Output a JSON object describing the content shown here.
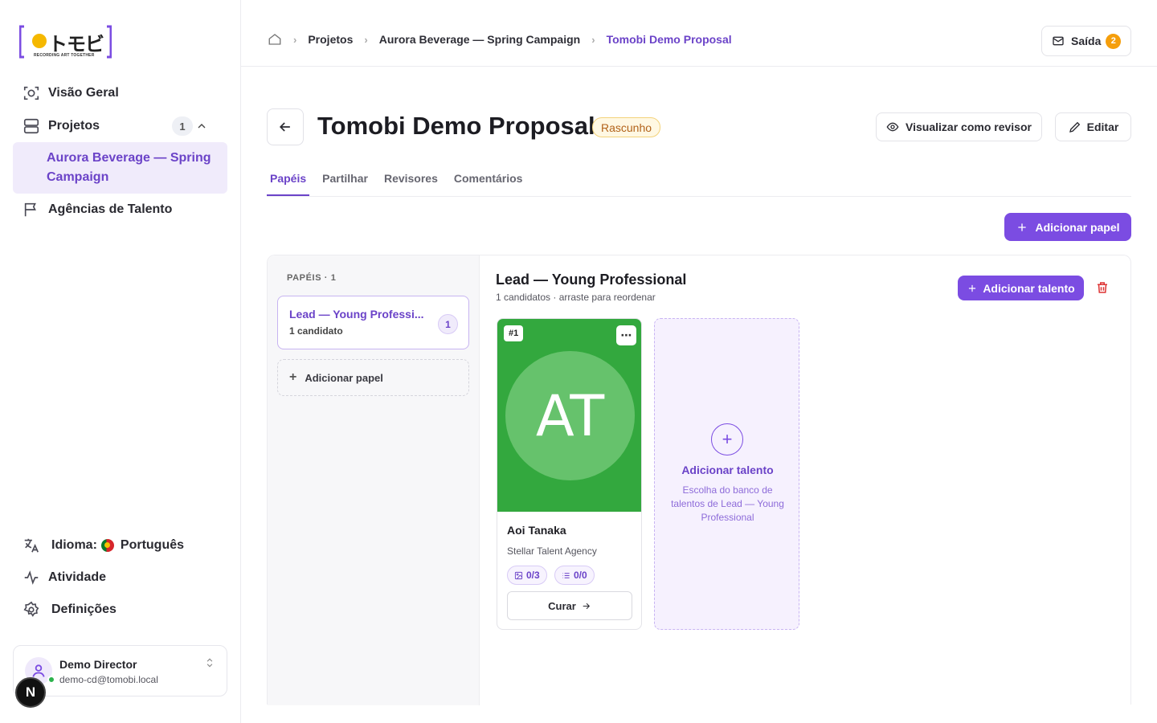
{
  "app": {
    "logo_text": "トモビ",
    "logo_tagline": "RECORDING ART TOGETHER"
  },
  "sidebar": {
    "nav": [
      {
        "label": "Visão Geral",
        "icon": "scan-icon"
      },
      {
        "label": "Projetos",
        "icon": "layers-icon",
        "count": "1"
      },
      {
        "label": "Agências de Talento",
        "icon": "flag-icon"
      }
    ],
    "active_project": "Aurora Beverage — Spring Campaign",
    "bottom": {
      "language_label": "Idioma:",
      "language_value": "Português",
      "activity": "Atividade",
      "settings": "Definições"
    },
    "user": {
      "name": "Demo Director",
      "email": "demo-cd@tomobi.local"
    },
    "next_badge": "N"
  },
  "header": {
    "breadcrumbs": [
      "Projetos",
      "Aurora Beverage — Spring Campaign",
      "Tomobi Demo Proposal"
    ],
    "exit_label": "Saída",
    "exit_count": "2"
  },
  "page": {
    "title": "Tomobi Demo Proposal",
    "status": "Rascunho",
    "preview_label": "Visualizar como revisor",
    "edit_label": "Editar",
    "tabs": [
      "Papéis",
      "Partilhar",
      "Revisores",
      "Comentários"
    ],
    "add_role_label": "Adicionar papel"
  },
  "roles": {
    "header": "PAPÉIS · 1",
    "items": [
      {
        "name": "Lead — Young Professi...",
        "sub": "1 candidato",
        "count": "1"
      }
    ],
    "add_label": "Adicionar papel"
  },
  "detail": {
    "title": "Lead — Young Professional",
    "subtitle": "1 candidatos · arraste para reordenar",
    "add_talent_label": "Adicionar talento",
    "talents": [
      {
        "rank": "#1",
        "initials": "AT",
        "name": "Aoi Tanaka",
        "agency": "Stellar Talent Agency",
        "photos": "0/3",
        "lists": "0/0",
        "action": "Curar",
        "color": "#33a83e"
      }
    ],
    "add_card": {
      "title": "Adicionar talento",
      "desc": "Escolha do banco de talentos de Lead — Young Professional"
    }
  },
  "colors": {
    "accent": "#7b4ce2",
    "draft_bg": "#fff8e3",
    "draft_fg": "#b2621a",
    "badge": "#f59e0b"
  }
}
